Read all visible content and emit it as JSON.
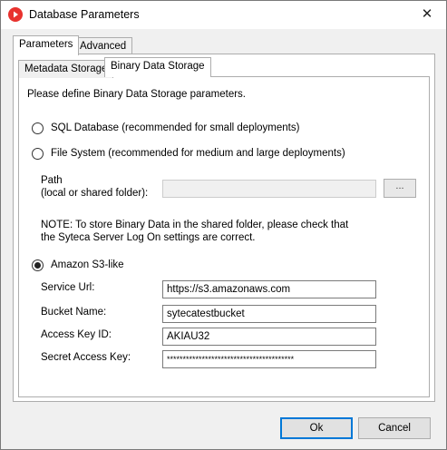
{
  "window": {
    "title": "Database Parameters",
    "close_glyph": "✕",
    "accent": "#0078d7",
    "app_icon_color": "#e8322e"
  },
  "tabs": [
    {
      "label": "Parameters"
    },
    {
      "label": "Advanced"
    }
  ],
  "subtabs": [
    {
      "label": "Metadata Storage"
    },
    {
      "label": "Binary Data Storage"
    }
  ],
  "binary": {
    "intro": "Please define Binary Data Storage parameters.",
    "options": [
      {
        "label": "SQL Database (recommended for small deployments)",
        "checked": false
      },
      {
        "label": "File System (recommended for medium and large deployments)",
        "checked": false
      },
      {
        "label": "Amazon S3-like",
        "checked": true
      }
    ],
    "path_label_1": "Path",
    "path_label_2": "(local or shared folder):",
    "path_value": "",
    "browse_label": "...",
    "note_1": "NOTE: To store Binary Data in the shared folder, please check that",
    "note_2": "the Syteca Server Log On settings are correct.",
    "s3": {
      "service_url_label": "Service Url:",
      "service_url_value": "https://s3.amazonaws.com",
      "bucket_label": "Bucket Name:",
      "bucket_value": "sytecatestbucket",
      "access_key_label": "Access Key ID:",
      "access_key_value": "AKIAU32",
      "secret_label": "Secret Access Key:",
      "secret_value": "****************************************"
    }
  },
  "buttons": {
    "ok": "Ok",
    "cancel": "Cancel"
  }
}
